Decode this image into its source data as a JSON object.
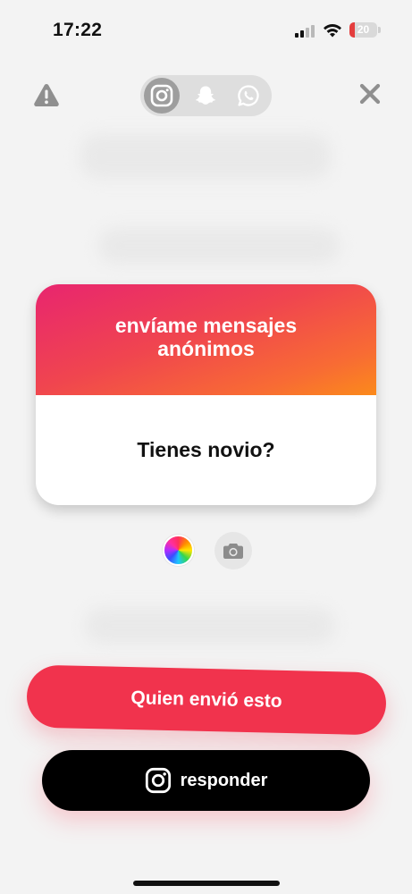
{
  "status_bar": {
    "time": "17:22",
    "battery_level": "20",
    "battery_fraction": 0.2,
    "signal_bars_active": 2,
    "signal_bars_total": 4
  },
  "header": {
    "warning_icon": "warning-triangle-icon",
    "close_icon": "close-x-icon",
    "share_targets": [
      {
        "name": "instagram",
        "icon": "instagram-icon",
        "selected": true
      },
      {
        "name": "snapchat",
        "icon": "snapchat-ghost-icon",
        "selected": false
      },
      {
        "name": "whatsapp",
        "icon": "whatsapp-icon",
        "selected": false
      }
    ]
  },
  "card": {
    "title": "envíame mensajes anónimos",
    "question": "Tienes novio?",
    "gradient_colors": [
      "#e8256f",
      "#fb8a1b"
    ]
  },
  "tools": {
    "color_picker_icon": "color-wheel-icon",
    "camera_icon": "camera-icon"
  },
  "actions": {
    "who_sent_label": "Quien envió esto",
    "reply_label": "responder",
    "reply_icon": "instagram-icon"
  },
  "colors": {
    "accent_red": "#f1334d",
    "background": "#f3f3f3"
  }
}
